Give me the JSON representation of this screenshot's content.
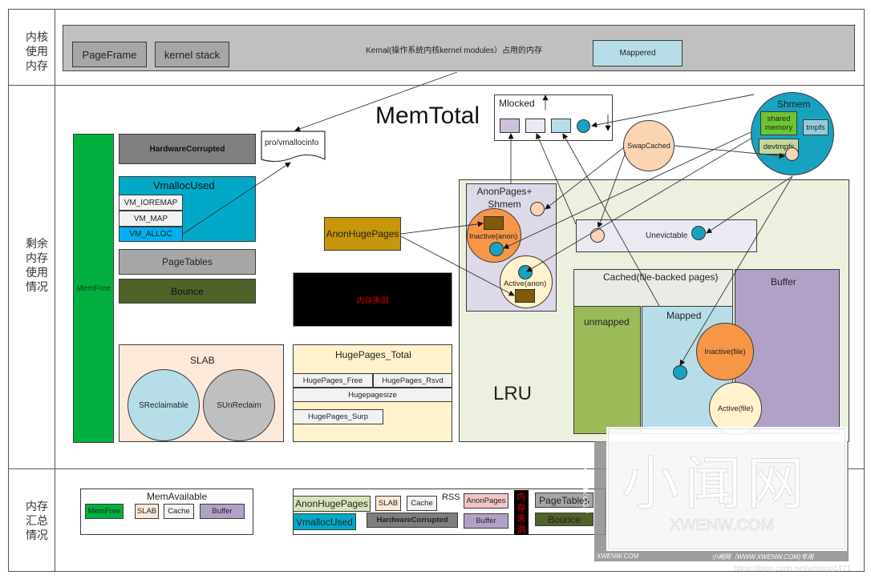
{
  "rows": {
    "kernel_label": [
      "内核",
      "使用",
      "内存"
    ],
    "remaining_label": [
      "剩余",
      "内存",
      "使用",
      "情况"
    ],
    "summary_label": [
      "内存",
      "汇总",
      "情况"
    ]
  },
  "kernel_section": {
    "page_frame": "PageFrame",
    "kernel_stack": "kernel stack",
    "description": "Kernal(操作系统内核kernel modules）占用的内存",
    "mappered": "Mappered"
  },
  "remaining_section": {
    "memtotal": "MemTotal",
    "memfree": "MemFree",
    "hardware_corrupted": "HardwareCorrupted",
    "vmallocinfo": "pro/vmallocinfo",
    "vmalloc_used": {
      "title": "VmallocUsed",
      "items": [
        "VM_IOREMAP",
        "VM_MAP",
        "VM_ALLOC"
      ]
    },
    "page_tables": "PageTables",
    "bounce": "Bounce",
    "anon_huge_pages": "AnonHugePages",
    "memory_black_hole": "内存黑洞",
    "slab": {
      "title": "SLAB",
      "reclaimable": "SReclaimable",
      "unreclaim": "SUnReclaim"
    },
    "huge_pages": {
      "title": "HugePages_Total",
      "free": "HugePages_Free",
      "rsvd": "HugePages_Rsvd",
      "size": "Hugepagesize",
      "surp": "HugePages_Surp"
    },
    "mlocked": "Mlocked",
    "swap_cached": "SwapCached",
    "shmem": {
      "title": "Shmem",
      "shared_memory": "shared memory",
      "tmpfs": "tmpfs",
      "devtmpfs": "devtmpfs"
    },
    "lru": {
      "title": "LRU",
      "anon_pages": "AnonPages+ Shmem",
      "inactive_anon": "Inactive(anon)",
      "active_anon": "Active(anon)",
      "unevictable": "Unevictable",
      "cached": "Cached(file-backed pages)",
      "unmapped": "unmapped",
      "mapped": "Mapped",
      "buffer": "Buffer",
      "inactive_file": "Inactive(file)",
      "active_file": "Active(file)"
    }
  },
  "summary_section": {
    "mem_available": {
      "title": "MemAvailable",
      "items": [
        "MemFree",
        "SLAB",
        "Cache",
        "Buffer"
      ]
    },
    "rss_group": {
      "anon_huge_pages": "AnonHugePages",
      "slab": "SLAB",
      "cache": "Cache",
      "rss": "RSS",
      "anon_pages": "AnonPages",
      "black_hole": "内存黑洞",
      "page_tables": "PageTables",
      "vmalloc_used": "VmallocUsed",
      "hardware_corrupted": "HardwareCorrupted",
      "buffer": "Buffer",
      "bounce": "Bounce"
    }
  },
  "watermark": {
    "big": "小闻网",
    "site": "XWENW.COM",
    "side": "XWENW.COM",
    "footer_left": "XWENW.COM",
    "footer_right": "小闻网（WWW.XWENW.COM)专用",
    "url": "https://blog.csdn.net/whbing1471"
  },
  "colors": {
    "memfree_green": "#00b140",
    "vmalloc_blue": "#00a9c8",
    "vm_alloc_blue": "#00b0f0",
    "bounce_green": "#4f6228",
    "anon_huge_gold": "#c8960a",
    "lru_bg": "#ebf1de",
    "anon_lavender": "#ddd9e8",
    "orange": "#f79646",
    "cream": "#fff2cc",
    "teal_dot": "#17a2c0",
    "peach": "#fbd4b4",
    "buffer_purple": "#b2a1c7",
    "unmapped_green": "#9bbb59",
    "mapped_blue": "#b7dee8"
  }
}
